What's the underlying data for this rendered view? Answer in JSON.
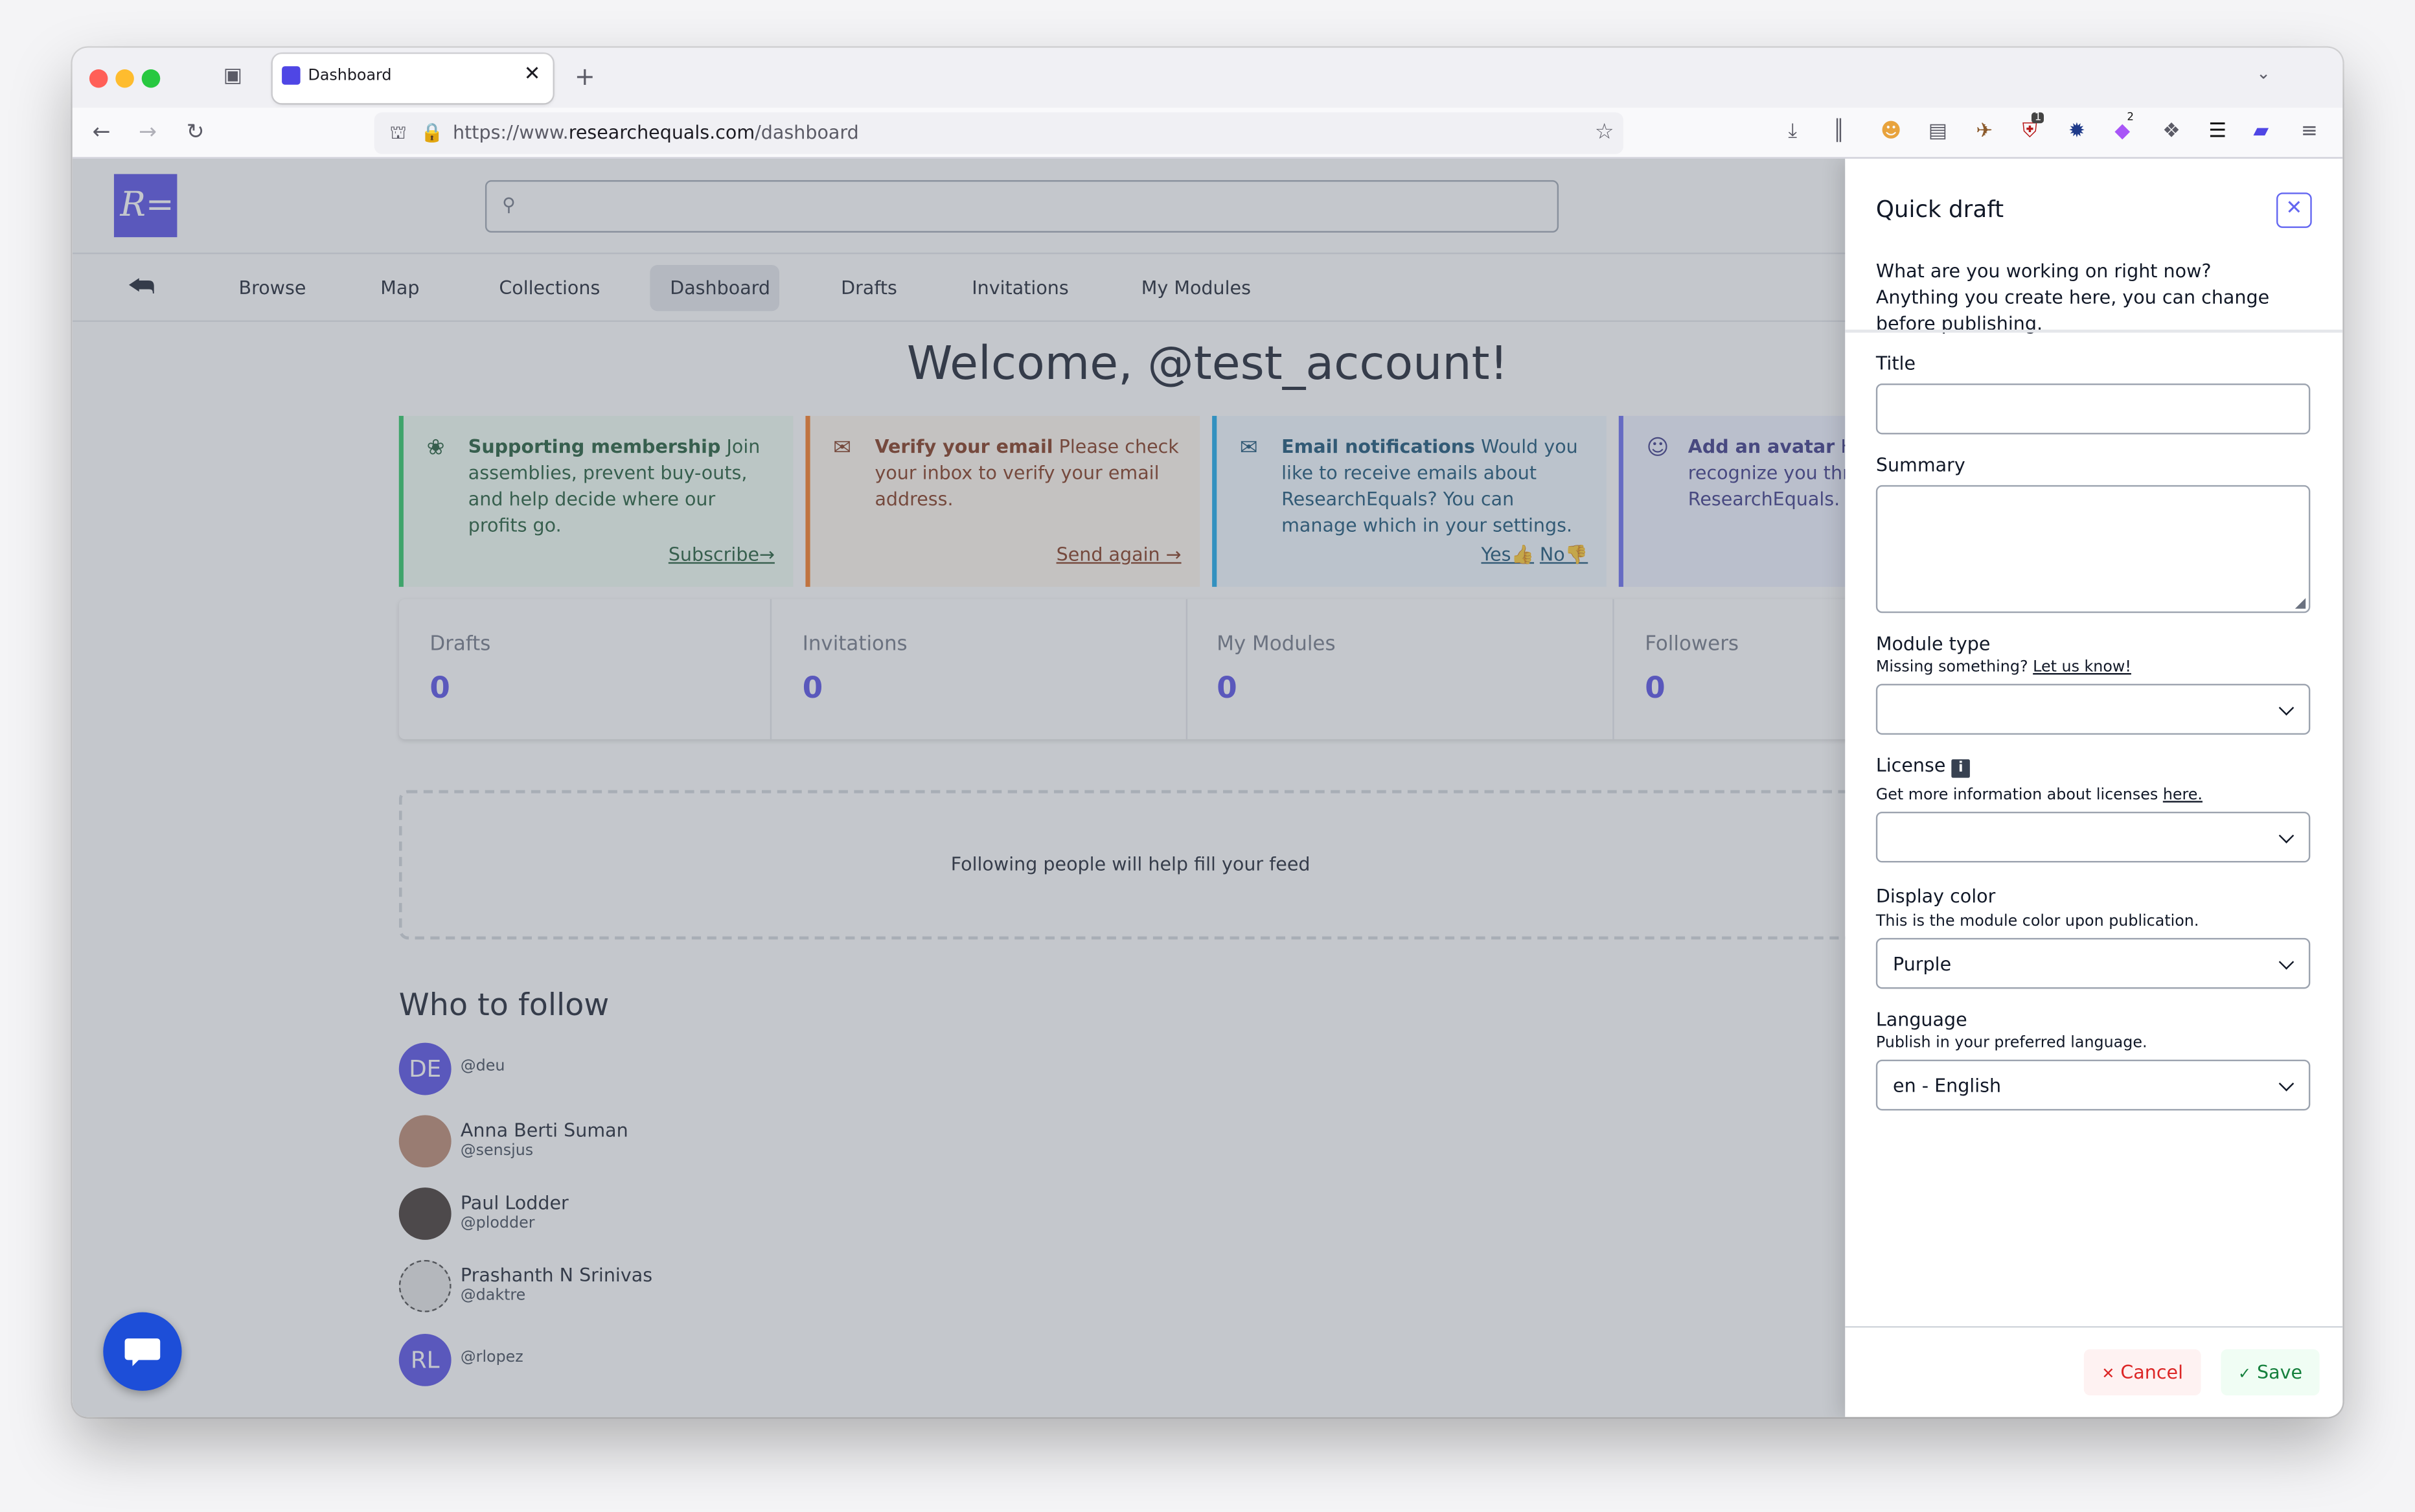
{
  "browser": {
    "tab_title": "Dashboard",
    "url_prefix": "https://www.",
    "url_domain": "researchequals.com",
    "url_path": "/dashboard",
    "ext_badge_1": "1",
    "ext_badge_2": "2"
  },
  "app": {
    "logo": "R=",
    "nav": [
      "Browse",
      "Map",
      "Collections",
      "Dashboard",
      "Drafts",
      "Invitations",
      "My Modules"
    ],
    "active_nav": "Dashboard"
  },
  "main": {
    "welcome": "Welcome, @test_account!",
    "cards": [
      {
        "title": "Supporting membership",
        "text": "Join assemblies, prevent buy-outs, and help decide where our profits go.",
        "cta": "Subscribe→"
      },
      {
        "title": "Verify your email",
        "text": "Please check your inbox to verify your email address.",
        "cta": "Send again →"
      },
      {
        "title": "Email notifications",
        "text": "Would you like to receive emails about ResearchEquals? You can manage which in your settings.",
        "yes": "Yes👍",
        "no": "No👎"
      },
      {
        "title": "Add an avatar",
        "text": "Help others recognize you throughout ResearchEquals."
      }
    ],
    "stats": [
      {
        "label": "Drafts",
        "value": "0"
      },
      {
        "label": "Invitations",
        "value": "0"
      },
      {
        "label": "My Modules",
        "value": "0"
      },
      {
        "label": "Followers",
        "value": "0"
      }
    ],
    "feed_empty": "Following people will help fill your feed",
    "who_to_follow": "Who to follow",
    "people": [
      {
        "initials": "DE",
        "name": "",
        "handle": "@deu"
      },
      {
        "initials": "",
        "name": "Anna Berti Suman",
        "handle": "@sensjus"
      },
      {
        "initials": "",
        "name": "Paul Lodder",
        "handle": "@plodder"
      },
      {
        "initials": "",
        "name": "Prashanth N Srinivas",
        "handle": "@daktre"
      },
      {
        "initials": "RL",
        "name": "",
        "handle": "@rlopez"
      }
    ]
  },
  "quick_draft": {
    "title": "Quick draft",
    "intro": "What are you working on right now? Anything you create here, you can change before publishing.",
    "title_label": "Title",
    "title_value": "",
    "summary_label": "Summary",
    "summary_value": "",
    "module_type_label": "Module type",
    "module_type_hint": "Missing something?",
    "module_type_link": "Let us know!",
    "module_type_value": "",
    "license_label": "License",
    "license_hint": "Get more information about licenses",
    "license_link": "here.",
    "license_value": "",
    "color_label": "Display color",
    "color_hint": "This is the module color upon publication.",
    "color_value": "Purple",
    "language_label": "Language",
    "language_hint": "Publish in your preferred language.",
    "language_value": "en - English",
    "cancel": "Cancel",
    "save": "Save"
  },
  "colors": {
    "brand": "#4f46e5",
    "green": "#16a34a",
    "orange": "#ea580c",
    "blue": "#0ea5e9",
    "indigo": "#6366f1",
    "cancel": "#dc2626",
    "save": "#15803d"
  }
}
